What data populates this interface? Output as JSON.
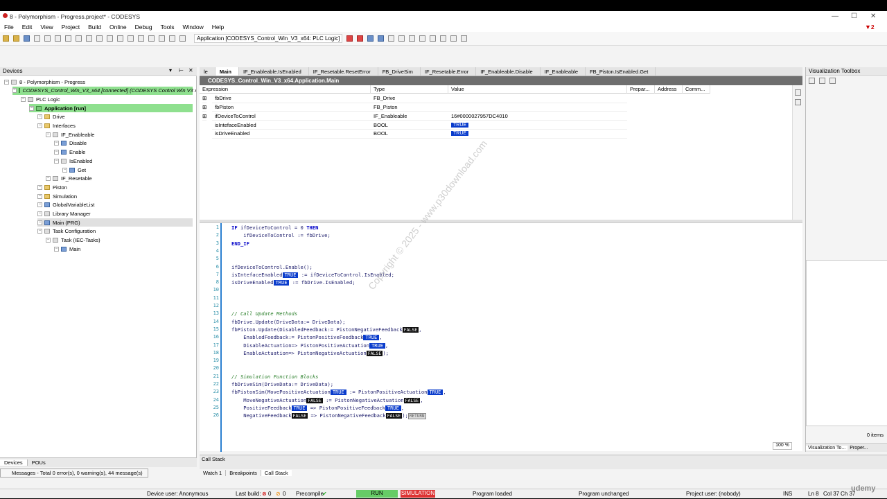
{
  "app": {
    "title": "8 - Polymorphism - Progress.project* - CODESYS",
    "win_min": "—",
    "win_max": "☐",
    "win_close": "✕",
    "notif_count": "2"
  },
  "menu": [
    "File",
    "Edit",
    "View",
    "Project",
    "Build",
    "Online",
    "Debug",
    "Tools",
    "Window",
    "Help"
  ],
  "toolbar": {
    "app_select": "Application [CODESYS_Control_Win_V3_x64: PLC Logic]"
  },
  "devices_panel": {
    "title": "Devices",
    "tree": [
      {
        "label": "8 - Polymorphism - Progress",
        "indent": 0,
        "icon": "project-icon"
      },
      {
        "label": "CODESYS_Control_Win_V3_x64 [connected] (CODESYS Control Win V3 x64)",
        "indent": 1,
        "icon": "device-icon",
        "hl": "green-italic"
      },
      {
        "label": "PLC Logic",
        "indent": 2,
        "icon": "plc-icon"
      },
      {
        "label": "Application [run]",
        "indent": 3,
        "icon": "application-icon",
        "hl": "green-bold"
      },
      {
        "label": "Drive",
        "indent": 4,
        "icon": "folder-icon"
      },
      {
        "label": "Interfaces",
        "indent": 4,
        "icon": "folder-icon"
      },
      {
        "label": "IF_Enableable",
        "indent": 5,
        "icon": "interface-icon"
      },
      {
        "label": "Disable",
        "indent": 6,
        "icon": "method-icon"
      },
      {
        "label": "Enable",
        "indent": 6,
        "icon": "method-icon"
      },
      {
        "label": "IsEnabled",
        "indent": 6,
        "icon": "property-icon"
      },
      {
        "label": "Get",
        "indent": 7,
        "icon": "method-icon"
      },
      {
        "label": "IF_Resetable",
        "indent": 5,
        "icon": "interface-icon"
      },
      {
        "label": "Piston",
        "indent": 4,
        "icon": "folder-icon"
      },
      {
        "label": "Simulation",
        "indent": 4,
        "icon": "folder-icon"
      },
      {
        "label": "GlobalVariableList",
        "indent": 4,
        "icon": "gvl-icon"
      },
      {
        "label": "Library Manager",
        "indent": 4,
        "icon": "library-icon"
      },
      {
        "label": "Main (PRG)",
        "indent": 4,
        "icon": "program-icon",
        "hl": "gray"
      },
      {
        "label": "Task Configuration",
        "indent": 4,
        "icon": "taskconfig-icon"
      },
      {
        "label": "Task (IEC-Tasks)",
        "indent": 5,
        "icon": "task-icon"
      },
      {
        "label": "Main",
        "indent": 6,
        "icon": "program-icon"
      }
    ],
    "bottom_tabs": [
      "Devices",
      "POUs"
    ]
  },
  "editor_tabs": [
    "le",
    "Main",
    "IF_Enableable.IsEnabled",
    "IF_Resetable.ResetError",
    "FB_DriveSim",
    "IF_Resetable.Error",
    "IF_Enableable.Disable",
    "IF_Enableable",
    "FB_Piston.IsEnabled.Get"
  ],
  "path": "CODESYS_Control_Win_V3_x64.Application.Main",
  "watch": {
    "headers": [
      "Expression",
      "Type",
      "Value",
      "Prepar...",
      "Address",
      "Comm..."
    ],
    "rows": [
      {
        "expr": "fbDrive",
        "type": "FB_Drive",
        "value": "",
        "bool": false
      },
      {
        "expr": "fbPiston",
        "type": "FB_Piston",
        "value": "",
        "bool": false
      },
      {
        "expr": "ifDeviceToControl",
        "type": "IF_Enableable",
        "value": "16#0000027957DC4010",
        "bool": false
      },
      {
        "expr": "isIntefaceEnabled",
        "type": "BOOL",
        "value": "TRUE",
        "bool": true
      },
      {
        "expr": "isDriveEnabled",
        "type": "BOOL",
        "value": "TRUE",
        "bool": true
      }
    ]
  },
  "code": [
    {
      "n": "1",
      "html": "<span class=\"kw\">IF</span> ifDeviceToControl = 0 <span class=\"kw\">THEN</span>"
    },
    {
      "n": "2",
      "html": "    ifDeviceToControl := fbDrive;"
    },
    {
      "n": "3",
      "html": "<span class=\"kw\">END_IF</span>"
    },
    {
      "n": "4",
      "html": ""
    },
    {
      "n": "5",
      "html": ""
    },
    {
      "n": "6",
      "html": "ifDeviceToControl.Enable();"
    },
    {
      "n": "7",
      "html": "isIntefaceEnabled<span class=\"bool\">TRUE</span> := ifDeviceToControl.IsEnabled;"
    },
    {
      "n": "8",
      "html": "isDriveEnabled<span class=\"bool\">TRUE</span> := fbDrive.IsEnabled;"
    },
    {
      "n": "10",
      "html": ""
    },
    {
      "n": "11",
      "html": ""
    },
    {
      "n": "12",
      "html": ""
    },
    {
      "n": "13",
      "html": "<span class=\"cm\">// Call Update Methods</span>"
    },
    {
      "n": "14",
      "html": "fbDrive.Update(DriveData:= DriveData);"
    },
    {
      "n": "15",
      "html": "fbPiston.Update(DisabledFeedback:= PistonNegativeFeedback<span class=\"boolf\">FALSE</span>,"
    },
    {
      "n": "16",
      "html": "    EnabledFeedback:= PistonPositiveFeedback<span class=\"bool\">TRUE</span>,"
    },
    {
      "n": "17",
      "html": "    DisableActuation=> PistonPositiveActuation<span class=\"bool\">TRUE</span>,"
    },
    {
      "n": "18",
      "html": "    EnableActuation=> PistonNegativeActuation<span class=\"boolf\">FALSE</span>);"
    },
    {
      "n": "19",
      "html": ""
    },
    {
      "n": "20",
      "html": ""
    },
    {
      "n": "21",
      "html": "<span class=\"cm\">// Simulation Function Blocks</span>"
    },
    {
      "n": "22",
      "html": "fbDriveSim(DriveData:= DriveData);"
    },
    {
      "n": "23",
      "html": "fbPistonSim(MovePositiveActuation<span class=\"bool\">TRUE</span> := PistonPositiveActuation<span class=\"bool\">TRUE</span>,"
    },
    {
      "n": "24",
      "html": "    MoveNegativeActuation<span class=\"boolf\">FALSE</span> := PistonNegativeActuation<span class=\"boolf\">FALSE</span>,"
    },
    {
      "n": "25",
      "html": "    PositiveFeedback<span class=\"bool\">TRUE</span> => PistonPositiveFeedback<span class=\"bool\">TRUE</span>,"
    },
    {
      "n": "26",
      "html": "    NegativeFeedback<span class=\"boolf\">FALSE</span> => PistonNegativeFeedback<span class=\"boolf\">FALSE</span>);<span style=\"border:1px solid #888;background:#ddd;color:#555;font-size:6px;padding:0 1px\">RETURN</span>"
    }
  ],
  "zoom": "100 %",
  "watermark": "Copyright © 2025 - www.p30download.com",
  "vis_toolbox": {
    "title": "Visualization Toolbox",
    "items": "0 items",
    "tab1": "Visualization To...",
    "tab2": "Proper..."
  },
  "callstack": {
    "title": "Call Stack",
    "tabs": [
      "Watch 1",
      "Breakpoints",
      "Call Stack"
    ]
  },
  "messages": "Messages - Total 0 error(s), 0 warning(s), 44 message(s)",
  "status": {
    "device_user": "Device user: Anonymous",
    "last_build": "Last build:",
    "err": "0",
    "warn": "0",
    "precompile": "Precompile",
    "run": "RUN",
    "sim": "SIMULATION",
    "loaded": "Program loaded",
    "unchanged": "Program unchanged",
    "project_user": "Project user: (nobody)",
    "ins": "INS",
    "ln": "Ln 8",
    "col": "Col 37",
    "ch": "Ch 37"
  },
  "udemy": "udemy"
}
